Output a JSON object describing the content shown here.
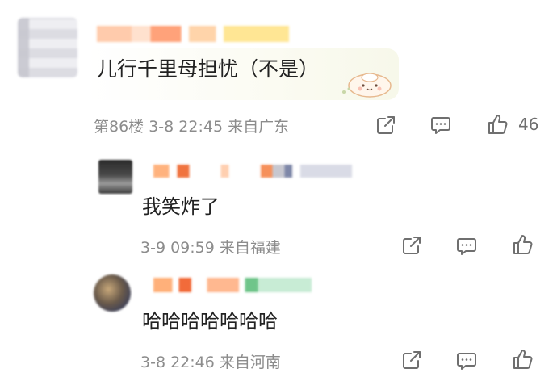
{
  "main_comment": {
    "text": "儿行千里母担忧（不是）",
    "floor_time_location": "第86楼  3-8 22:45  来自广东",
    "like_count": "46",
    "sticker_icon": "smiling-bun-sticker"
  },
  "replies": [
    {
      "text": "我笑炸了",
      "time_location": "3-9 09:59  来自福建"
    },
    {
      "text": "哈哈哈哈哈哈哈",
      "time_location": "3-8 22:46  来自河南"
    }
  ],
  "icons": {
    "share": "share-icon",
    "comment": "comment-icon",
    "like": "thumbs-up-icon"
  },
  "colors": {
    "meta_text": "#8c8c8c",
    "icon_stroke": "#6f6f6f",
    "bubble_bg": "#f7f8ea"
  }
}
